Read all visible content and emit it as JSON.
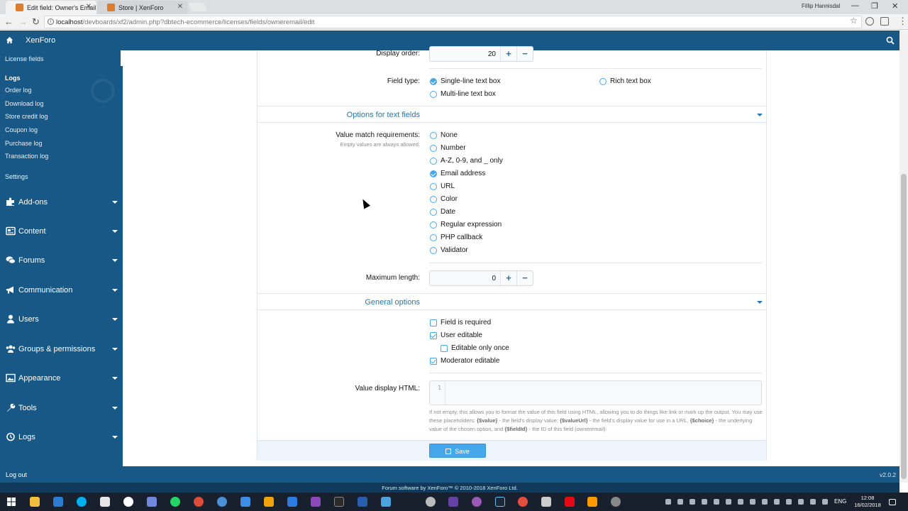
{
  "browser": {
    "tabs": [
      {
        "title": "Edit field: Owner's Email"
      },
      {
        "title": "Store | XenForo"
      }
    ],
    "window_user": "Fillip Hannisdal",
    "url_host": "localhost",
    "url_path": "/devboards/xf2/admin.php?dbtech-ecommerce/licenses/fields/owneremail/edit"
  },
  "header": {
    "brand": "XenForo"
  },
  "sidebar": {
    "sub_items_top": [
      "License fields"
    ],
    "logs_heading": "Logs",
    "log_items": [
      "Order log",
      "Download log",
      "Store credit log",
      "Coupon log",
      "Purchase log",
      "Transaction log"
    ],
    "settings": "Settings",
    "sections": [
      "Add-ons",
      "Content",
      "Forums",
      "Communication",
      "Users",
      "Groups & permissions",
      "Appearance",
      "Tools",
      "Logs"
    ]
  },
  "form": {
    "display_order": {
      "label": "Display order:",
      "value": "20"
    },
    "field_type": {
      "label": "Field type:",
      "options": [
        {
          "label": "Single-line text box",
          "selected": true
        },
        {
          "label": "Rich text box",
          "selected": false
        },
        {
          "label": "Multi-line text box",
          "selected": false
        }
      ]
    },
    "text_section_title": "Options for text fields",
    "value_match": {
      "label": "Value match requirements:",
      "hint": "Empty values are always allowed.",
      "options": [
        {
          "label": "None",
          "selected": false
        },
        {
          "label": "Number",
          "selected": false
        },
        {
          "label": "A-Z, 0-9, and _ only",
          "selected": false
        },
        {
          "label": "Email address",
          "selected": true
        },
        {
          "label": "URL",
          "selected": false
        },
        {
          "label": "Color",
          "selected": false
        },
        {
          "label": "Date",
          "selected": false
        },
        {
          "label": "Regular expression",
          "selected": false
        },
        {
          "label": "PHP callback",
          "selected": false
        },
        {
          "label": "Validator",
          "selected": false
        }
      ]
    },
    "max_length": {
      "label": "Maximum length:",
      "value": "0"
    },
    "general_section_title": "General options",
    "general_options": [
      {
        "label": "Field is required",
        "checked": false
      },
      {
        "label": "User editable",
        "checked": true
      },
      {
        "label": "Editable only once",
        "checked": false
      },
      {
        "label": "Moderator editable",
        "checked": true
      }
    ],
    "value_display_html": {
      "label": "Value display HTML:",
      "line_number": "1",
      "explain_1": "If not empty, this allows you to format the value of this field using HTML, allowing you to do things like link or mark up the output. You may use these placeholders: ",
      "ph_value": "{$value}",
      "explain_2": " - the field's display value; ",
      "ph_value_url": "{$valueUrl}",
      "explain_3": " - the field's display value for use in a URL, ",
      "ph_choice": "{$choice}",
      "explain_4": " - the underlying value of the chosen option, and ",
      "ph_field_id": "{$fieldId}",
      "explain_5": " - the ID of this field (owneremail)."
    },
    "save_label": "Save"
  },
  "footer": {
    "logout": "Log out",
    "version": "v2.0.2",
    "copyright": "Forum software by XenForo™ © 2010-2018 XenForo Ltd."
  },
  "taskbar": {
    "language": "ENG",
    "time": "12:08",
    "date": "16/02/2018"
  },
  "colors": {
    "header_bg": "#185886",
    "accent": "#47a7eb",
    "link": "#2577b1"
  }
}
